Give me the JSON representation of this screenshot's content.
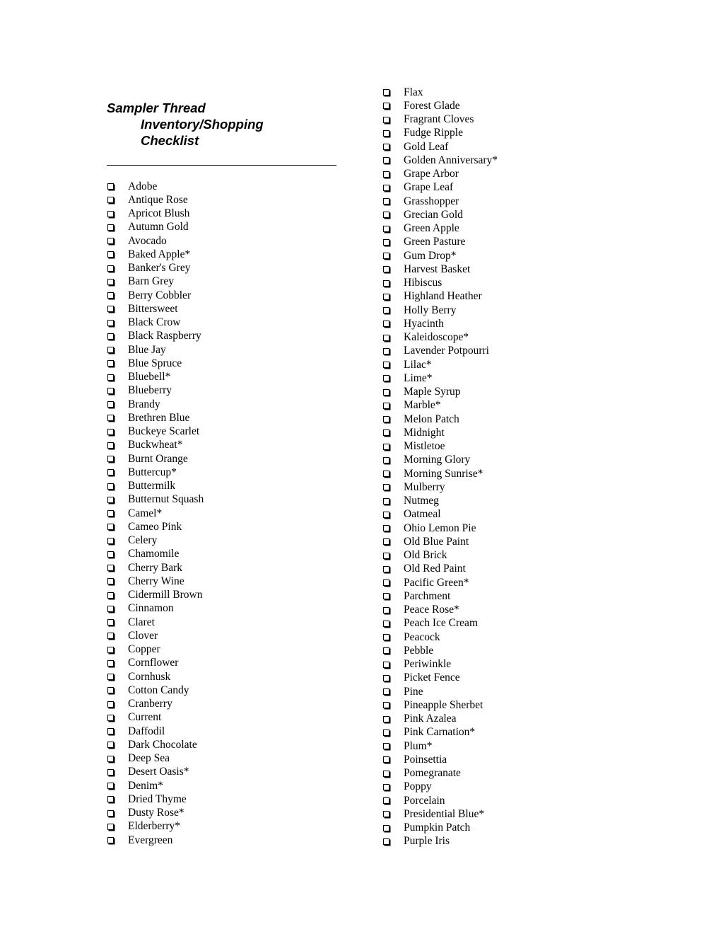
{
  "title": {
    "line1": "Sampler Thread",
    "line2": "Inventory/Shopping",
    "line3": "Checklist"
  },
  "left_column": [
    "Adobe",
    "Antique Rose",
    "Apricot Blush",
    "Autumn Gold",
    "Avocado",
    "Baked Apple*",
    "Banker's Grey",
    "Barn Grey",
    "Berry Cobbler",
    "Bittersweet",
    "Black Crow",
    "Black Raspberry",
    "Blue Jay",
    "Blue Spruce",
    "Bluebell*",
    "Blueberry",
    "Brandy",
    "Brethren Blue",
    "Buckeye Scarlet",
    "Buckwheat*",
    "Burnt Orange",
    "Buttercup*",
    "Buttermilk",
    "Butternut Squash",
    "Camel*",
    "Cameo Pink",
    "Celery",
    "Chamomile",
    "Cherry Bark",
    "Cherry Wine",
    "Cidermill Brown",
    "Cinnamon",
    "Claret",
    "Clover",
    "Copper",
    "Cornflower",
    "Cornhusk",
    "Cotton Candy",
    "Cranberry",
    "Current",
    "Daffodil",
    "Dark Chocolate",
    "Deep Sea",
    "Desert Oasis*",
    "Denim*",
    "Dried Thyme",
    "Dusty Rose*",
    "Elderberry*",
    "Evergreen"
  ],
  "right_column": [
    "Flax",
    "Forest Glade",
    "Fragrant Cloves",
    "Fudge Ripple",
    "Gold Leaf",
    "Golden Anniversary*",
    "Grape Arbor",
    "Grape Leaf",
    "Grasshopper",
    "Grecian Gold",
    "Green Apple",
    "Green Pasture",
    "Gum Drop*",
    "Harvest Basket",
    "Hibiscus",
    "Highland Heather",
    "Holly Berry",
    "Hyacinth",
    "Kaleidoscope*",
    "Lavender Potpourri",
    "Lilac*",
    "Lime*",
    "Maple Syrup",
    "Marble*",
    "Melon Patch",
    "Midnight",
    "Mistletoe",
    "Morning Glory",
    "Morning Sunrise*",
    "Mulberry",
    "Nutmeg",
    "Oatmeal",
    "Ohio Lemon Pie",
    "Old Blue Paint",
    "Old Brick",
    "Old Red Paint",
    "Pacific Green*",
    "Parchment",
    "Peace Rose*",
    "Peach Ice Cream",
    "Peacock",
    "Pebble",
    "Periwinkle",
    "Picket Fence",
    "Pine",
    "Pineapple Sherbet",
    "Pink Azalea",
    "Pink Carnation*",
    "Plum*",
    "Poinsettia",
    "Pomegranate",
    "Poppy",
    "Porcelain",
    "Presidential Blue*",
    "Pumpkin Patch",
    "Purple Iris"
  ],
  "checkbox_icon": "empty-square-checkbox"
}
